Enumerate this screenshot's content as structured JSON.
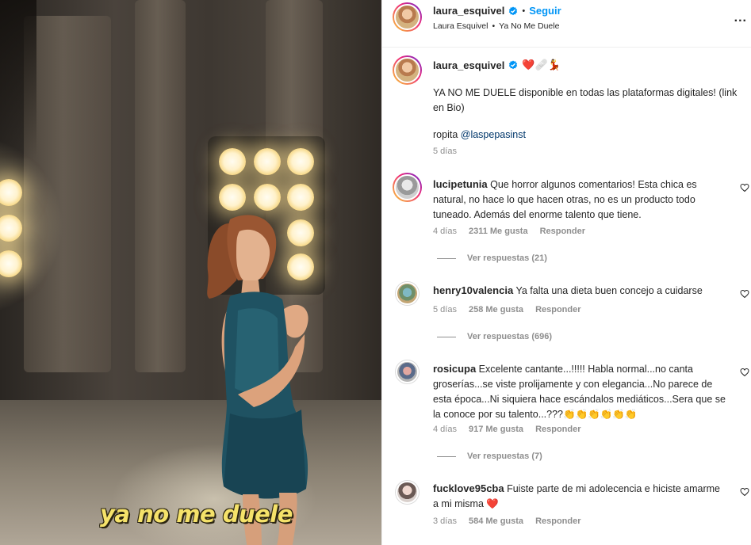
{
  "video": {
    "caption": "ya no me duele"
  },
  "header": {
    "username": "laura_esquivel",
    "separator": "•",
    "follow_label": "Seguir",
    "subtitle_name": "Laura Esquivel",
    "subtitle_sep": "•",
    "subtitle_song": "Ya No Me Duele",
    "more_label": "..."
  },
  "post": {
    "username": "laura_esquivel",
    "emojis": "❤️🩹💃",
    "text": "YA NO ME DUELE disponible en todas las plataformas digitales! (link en Bio)",
    "credit_prefix": "ropita",
    "credit_mention": "@laspepasinst",
    "age": "5 días"
  },
  "comments": [
    {
      "username": "lucipetunia",
      "text": "Que horror algunos comentarios! Esta chica es natural, no hace lo que hacen otras, no es un producto todo tuneado. Además del enorme talento que tiene.",
      "age": "4 días",
      "likes": "2311 Me gusta",
      "reply": "Responder",
      "view_replies": "Ver respuestas (21)"
    },
    {
      "username": "henry10valencia",
      "text": "Ya falta una dieta buen concejo a cuidarse",
      "age": "5 días",
      "likes": "258 Me gusta",
      "reply": "Responder",
      "view_replies": "Ver respuestas (696)"
    },
    {
      "username": "rosicupa",
      "text": "Excelente cantante...!!!!! Habla normal...no canta groserías...se viste prolijamente y con elegancia...No parece de esta época...Ni siquiera hace escándalos mediáticos...Sera que se la conoce por su talento...???👏👏👏👏👏👏",
      "age": "4 días",
      "likes": "917 Me gusta",
      "reply": "Responder",
      "view_replies": "Ver respuestas (7)"
    },
    {
      "username": "fucklove95cba",
      "text": "Fuiste parte de mi adolecencia e hiciste amarme a mi misma ❤️",
      "age": "3 días",
      "likes": "584 Me gusta",
      "reply": "Responder"
    }
  ],
  "colors": {
    "accent": "#0095f6",
    "muted": "#8e8e8e",
    "caption_yellow": "#f5e26a"
  }
}
